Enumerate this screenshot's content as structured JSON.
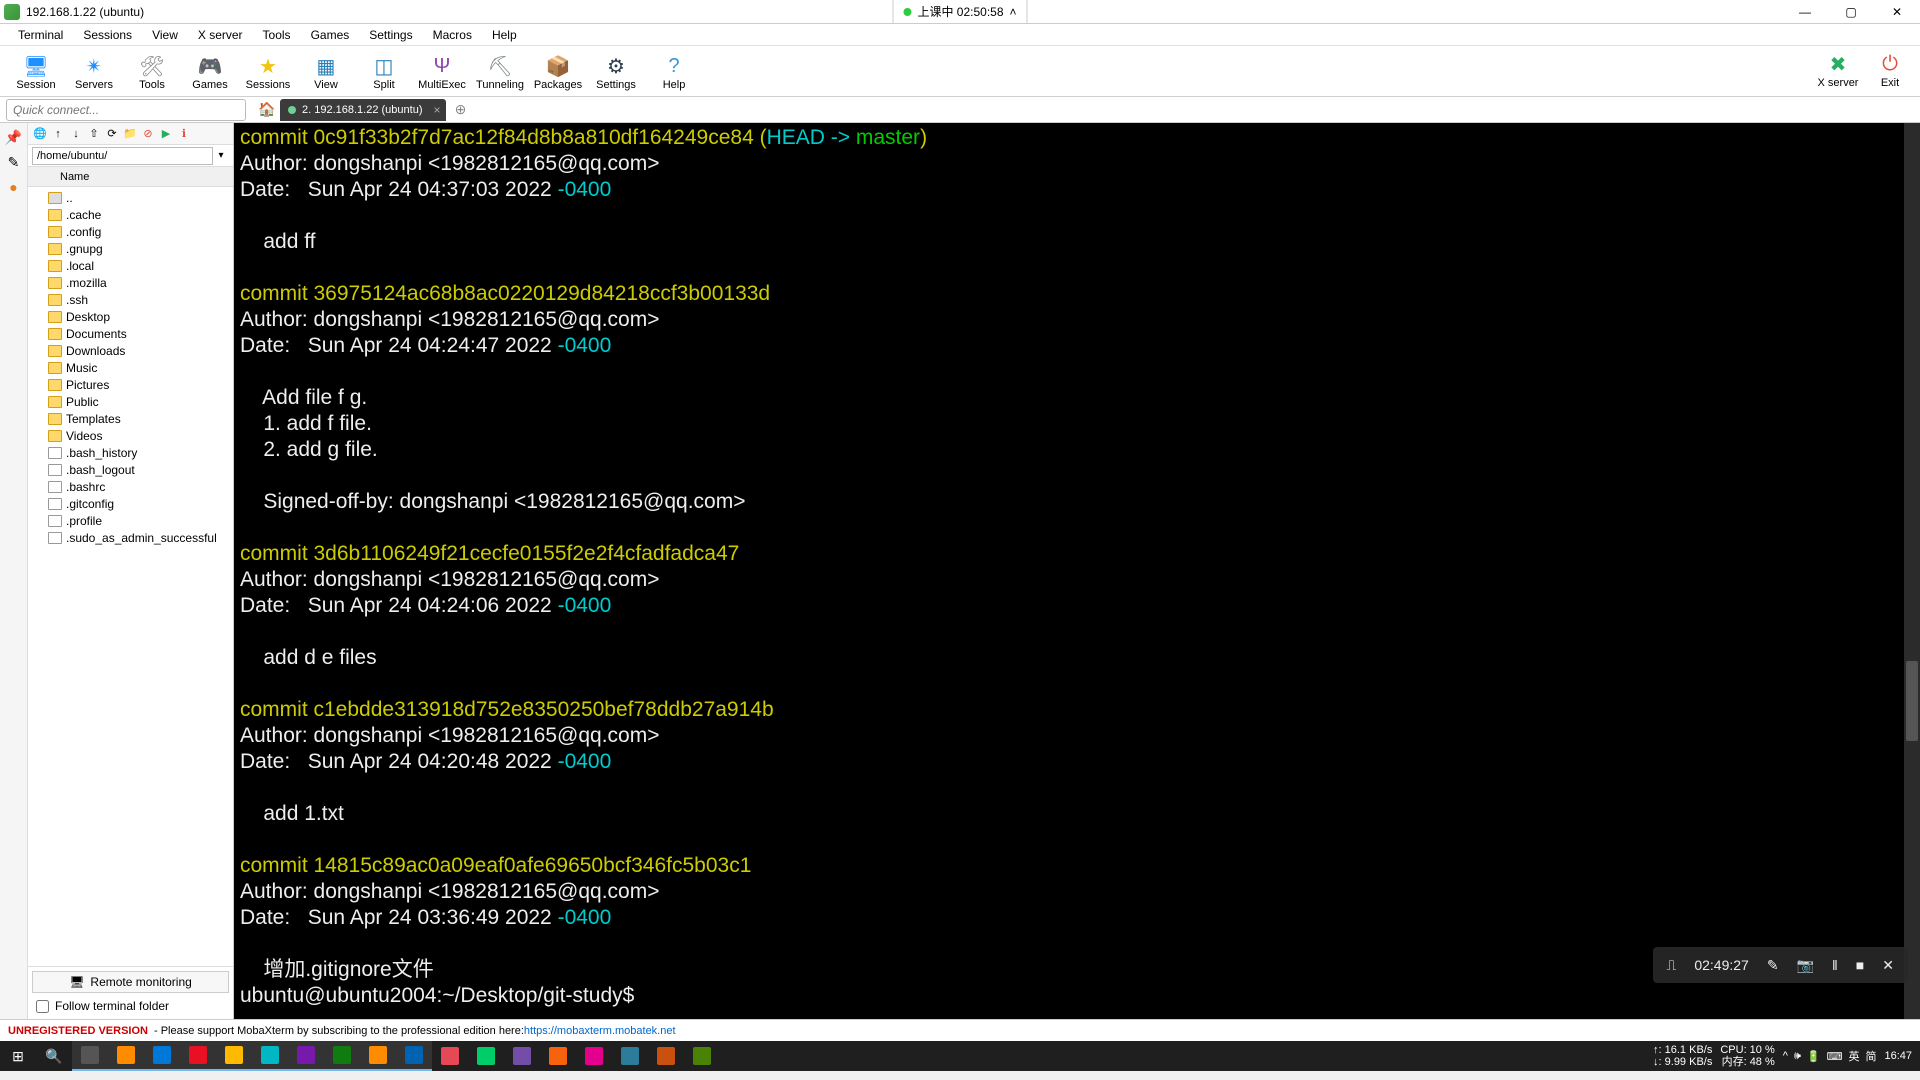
{
  "title": "192.168.1.22 (ubuntu)",
  "center_badge": {
    "text": "上课中 02:50:58"
  },
  "menu": [
    "Terminal",
    "Sessions",
    "View",
    "X server",
    "Tools",
    "Games",
    "Settings",
    "Macros",
    "Help"
  ],
  "toolbar": [
    {
      "label": "Session",
      "glyph": "🖥",
      "color": "#1e90ff"
    },
    {
      "label": "Servers",
      "glyph": "✴",
      "color": "#1e90ff"
    },
    {
      "label": "Tools",
      "glyph": "🛠",
      "color": "#888"
    },
    {
      "label": "Games",
      "glyph": "🎮",
      "color": "#e67e22"
    },
    {
      "label": "Sessions",
      "glyph": "★",
      "color": "#f1c40f"
    },
    {
      "label": "View",
      "glyph": "▦",
      "color": "#2980b9"
    },
    {
      "label": "Split",
      "glyph": "◫",
      "color": "#2980b9"
    },
    {
      "label": "MultiExec",
      "glyph": "Ψ",
      "color": "#8e44ad"
    },
    {
      "label": "Tunneling",
      "glyph": "⛏",
      "color": "#7f8c8d"
    },
    {
      "label": "Packages",
      "glyph": "📦",
      "color": "#c0a16b"
    },
    {
      "label": "Settings",
      "glyph": "⚙",
      "color": "#2c3e50"
    },
    {
      "label": "Help",
      "glyph": "?",
      "color": "#3498db"
    }
  ],
  "toolbar_right": [
    {
      "label": "X server",
      "glyph": "✖",
      "color": "#27ae60"
    },
    {
      "label": "Exit",
      "glyph": "⏻",
      "color": "#e74c3c"
    }
  ],
  "quick_connect": {
    "placeholder": "Quick connect..."
  },
  "tab": {
    "label": "2. 192.168.1.22 (ubuntu)"
  },
  "sidebar": {
    "path": "/home/ubuntu/",
    "header": "Name",
    "items": [
      {
        "name": "..",
        "type": "up"
      },
      {
        "name": ".cache",
        "type": "dir"
      },
      {
        "name": ".config",
        "type": "dir"
      },
      {
        "name": ".gnupg",
        "type": "dir"
      },
      {
        "name": ".local",
        "type": "dir"
      },
      {
        "name": ".mozilla",
        "type": "dir"
      },
      {
        "name": ".ssh",
        "type": "dir"
      },
      {
        "name": "Desktop",
        "type": "dir"
      },
      {
        "name": "Documents",
        "type": "dir"
      },
      {
        "name": "Downloads",
        "type": "dir"
      },
      {
        "name": "Music",
        "type": "dir"
      },
      {
        "name": "Pictures",
        "type": "dir"
      },
      {
        "name": "Public",
        "type": "dir"
      },
      {
        "name": "Templates",
        "type": "dir"
      },
      {
        "name": "Videos",
        "type": "dir"
      },
      {
        "name": ".bash_history",
        "type": "file"
      },
      {
        "name": ".bash_logout",
        "type": "file"
      },
      {
        "name": ".bashrc",
        "type": "file"
      },
      {
        "name": ".gitconfig",
        "type": "file"
      },
      {
        "name": ".profile",
        "type": "file"
      },
      {
        "name": ".sudo_as_admin_successful",
        "type": "file"
      }
    ],
    "remote_monitoring": "Remote monitoring",
    "follow": "Follow terminal folder"
  },
  "terminal": {
    "commits": [
      {
        "hash": "0c91f33b2f7d7ac12f84d8b8a810df164249ce84",
        "ref_head": "HEAD -> ",
        "ref_branch": "master",
        "author": "dongshanpi <1982812165@qq.com>",
        "date_main": "Sun Apr 24 04:37:03 2022 ",
        "date_tz": "-0400",
        "body": [
          "    add ff"
        ]
      },
      {
        "hash": "36975124ac68b8ac0220129d84218ccf3b00133d",
        "author": "dongshanpi <1982812165@qq.com>",
        "date_main": "Sun Apr 24 04:24:47 2022 ",
        "date_tz": "-0400",
        "body": [
          "    Add file f g.",
          "    1. add f file.",
          "    2. add g file.",
          "    ",
          "    Signed-off-by: dongshanpi <1982812165@qq.com>"
        ]
      },
      {
        "hash": "3d6b1106249f21cecfe0155f2e2f4cfadfadca47",
        "author": "dongshanpi <1982812165@qq.com>",
        "date_main": "Sun Apr 24 04:24:06 2022 ",
        "date_tz": "-0400",
        "body": [
          "    add d e files"
        ]
      },
      {
        "hash": "c1ebdde313918d752e8350250bef78ddb27a914b",
        "author": "dongshanpi <1982812165@qq.com>",
        "date_main": "Sun Apr 24 04:20:48 2022 ",
        "date_tz": "-0400",
        "body": [
          "    add 1.txt"
        ]
      },
      {
        "hash": "14815c89ac0a09eaf0afe69650bcf346fc5b03c1",
        "author": "dongshanpi <1982812165@qq.com>",
        "date_main": "Sun Apr 24 03:36:49 2022 ",
        "date_tz": "-0400",
        "body": [
          "    增加.gitignore文件"
        ]
      }
    ],
    "labels": {
      "commit": "commit ",
      "author": "Author: ",
      "date": "Date:   "
    },
    "prompt": "ubuntu@ubuntu2004:~/Desktop/git-study$",
    "caret_pos": "                       "
  },
  "rec": {
    "time": "02:49:27",
    "icons": [
      "⎍",
      "✎",
      "📷",
      "‖",
      "■",
      "✕"
    ]
  },
  "footer": {
    "unreg": "UNREGISTERED VERSION",
    "text": " - Please support MobaXterm by subscribing to the professional edition here: ",
    "link": "https://mobaxterm.mobatek.net"
  },
  "taskbar": {
    "left_count": 20,
    "net": {
      "l1": "↑: 16.1 KB/s",
      "l2": "↓: 9.99 KB/s"
    },
    "cpu": {
      "l1": "CPU: 10 %",
      "l2": "内存: 48 %"
    },
    "tray": [
      "^",
      "🕪",
      "🔋",
      "⌨",
      "英",
      "简"
    ],
    "clock": "16:47"
  }
}
